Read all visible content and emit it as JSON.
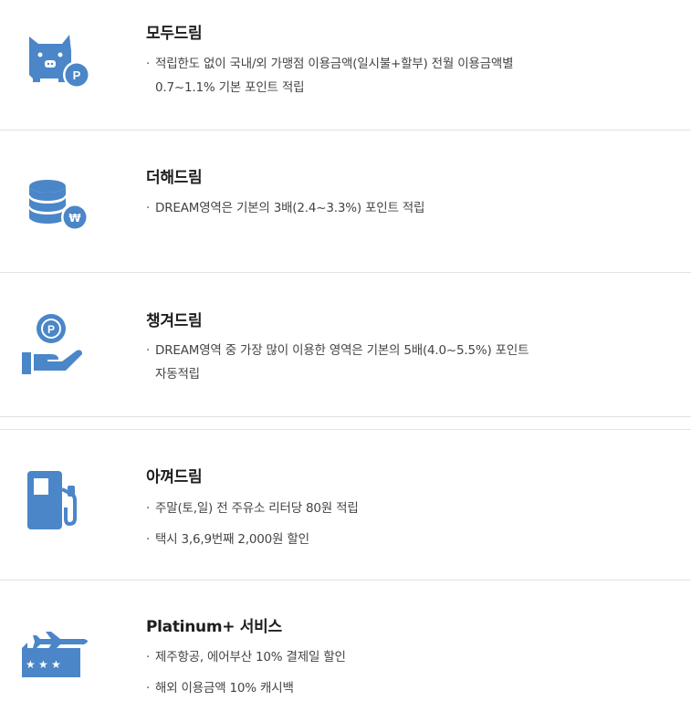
{
  "accent_color": "#4a86c8",
  "benefits": [
    {
      "icon": "piggy-point-icon",
      "title": "모두드림",
      "lines": [
        "적립한도 없이 국내/외 가맹점 이용금액(일시불+할부) 전월 이용금액별"
      ],
      "continuation": "0.7~1.1% 기본 포인트 적립"
    },
    {
      "icon": "coin-stack-won-icon",
      "title": "더해드림",
      "lines": [
        "DREAM영역은 기본의 3배(2.4~3.3%) 포인트 적립"
      ]
    },
    {
      "icon": "hand-coin-icon",
      "title": "챙겨드림",
      "lines": [
        "DREAM영역 중 가장 많이 이용한 영역은 기본의 5배(4.0~5.5%) 포인트"
      ],
      "continuation": "자동적립"
    },
    {
      "icon": "fuel-pump-icon",
      "title": "아껴드림",
      "lines": [
        "주말(토,일) 전 주유소 리터당 80원 적립",
        "택시 3,6,9번째 2,000원 할인"
      ]
    },
    {
      "icon": "airplane-ticket-icon",
      "title": "Platinum+ 서비스",
      "lines": [
        "제주항공, 에어부산 10% 결제일 할인",
        "해외 이용금액 10% 캐시백"
      ]
    }
  ]
}
